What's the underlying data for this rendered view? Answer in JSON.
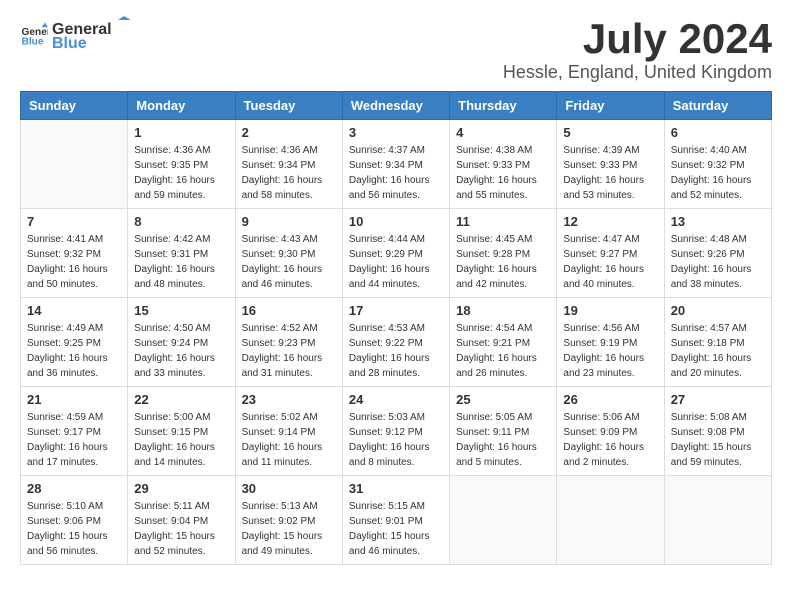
{
  "logo": {
    "general": "General",
    "blue": "Blue"
  },
  "header": {
    "title": "July 2024",
    "subtitle": "Hessle, England, United Kingdom"
  },
  "days_of_week": [
    "Sunday",
    "Monday",
    "Tuesday",
    "Wednesday",
    "Thursday",
    "Friday",
    "Saturday"
  ],
  "weeks": [
    [
      {
        "day": "",
        "info": ""
      },
      {
        "day": "1",
        "info": "Sunrise: 4:36 AM\nSunset: 9:35 PM\nDaylight: 16 hours\nand 59 minutes."
      },
      {
        "day": "2",
        "info": "Sunrise: 4:36 AM\nSunset: 9:34 PM\nDaylight: 16 hours\nand 58 minutes."
      },
      {
        "day": "3",
        "info": "Sunrise: 4:37 AM\nSunset: 9:34 PM\nDaylight: 16 hours\nand 56 minutes."
      },
      {
        "day": "4",
        "info": "Sunrise: 4:38 AM\nSunset: 9:33 PM\nDaylight: 16 hours\nand 55 minutes."
      },
      {
        "day": "5",
        "info": "Sunrise: 4:39 AM\nSunset: 9:33 PM\nDaylight: 16 hours\nand 53 minutes."
      },
      {
        "day": "6",
        "info": "Sunrise: 4:40 AM\nSunset: 9:32 PM\nDaylight: 16 hours\nand 52 minutes."
      }
    ],
    [
      {
        "day": "7",
        "info": "Sunrise: 4:41 AM\nSunset: 9:32 PM\nDaylight: 16 hours\nand 50 minutes."
      },
      {
        "day": "8",
        "info": "Sunrise: 4:42 AM\nSunset: 9:31 PM\nDaylight: 16 hours\nand 48 minutes."
      },
      {
        "day": "9",
        "info": "Sunrise: 4:43 AM\nSunset: 9:30 PM\nDaylight: 16 hours\nand 46 minutes."
      },
      {
        "day": "10",
        "info": "Sunrise: 4:44 AM\nSunset: 9:29 PM\nDaylight: 16 hours\nand 44 minutes."
      },
      {
        "day": "11",
        "info": "Sunrise: 4:45 AM\nSunset: 9:28 PM\nDaylight: 16 hours\nand 42 minutes."
      },
      {
        "day": "12",
        "info": "Sunrise: 4:47 AM\nSunset: 9:27 PM\nDaylight: 16 hours\nand 40 minutes."
      },
      {
        "day": "13",
        "info": "Sunrise: 4:48 AM\nSunset: 9:26 PM\nDaylight: 16 hours\nand 38 minutes."
      }
    ],
    [
      {
        "day": "14",
        "info": "Sunrise: 4:49 AM\nSunset: 9:25 PM\nDaylight: 16 hours\nand 36 minutes."
      },
      {
        "day": "15",
        "info": "Sunrise: 4:50 AM\nSunset: 9:24 PM\nDaylight: 16 hours\nand 33 minutes."
      },
      {
        "day": "16",
        "info": "Sunrise: 4:52 AM\nSunset: 9:23 PM\nDaylight: 16 hours\nand 31 minutes."
      },
      {
        "day": "17",
        "info": "Sunrise: 4:53 AM\nSunset: 9:22 PM\nDaylight: 16 hours\nand 28 minutes."
      },
      {
        "day": "18",
        "info": "Sunrise: 4:54 AM\nSunset: 9:21 PM\nDaylight: 16 hours\nand 26 minutes."
      },
      {
        "day": "19",
        "info": "Sunrise: 4:56 AM\nSunset: 9:19 PM\nDaylight: 16 hours\nand 23 minutes."
      },
      {
        "day": "20",
        "info": "Sunrise: 4:57 AM\nSunset: 9:18 PM\nDaylight: 16 hours\nand 20 minutes."
      }
    ],
    [
      {
        "day": "21",
        "info": "Sunrise: 4:59 AM\nSunset: 9:17 PM\nDaylight: 16 hours\nand 17 minutes."
      },
      {
        "day": "22",
        "info": "Sunrise: 5:00 AM\nSunset: 9:15 PM\nDaylight: 16 hours\nand 14 minutes."
      },
      {
        "day": "23",
        "info": "Sunrise: 5:02 AM\nSunset: 9:14 PM\nDaylight: 16 hours\nand 11 minutes."
      },
      {
        "day": "24",
        "info": "Sunrise: 5:03 AM\nSunset: 9:12 PM\nDaylight: 16 hours\nand 8 minutes."
      },
      {
        "day": "25",
        "info": "Sunrise: 5:05 AM\nSunset: 9:11 PM\nDaylight: 16 hours\nand 5 minutes."
      },
      {
        "day": "26",
        "info": "Sunrise: 5:06 AM\nSunset: 9:09 PM\nDaylight: 16 hours\nand 2 minutes."
      },
      {
        "day": "27",
        "info": "Sunrise: 5:08 AM\nSunset: 9:08 PM\nDaylight: 15 hours\nand 59 minutes."
      }
    ],
    [
      {
        "day": "28",
        "info": "Sunrise: 5:10 AM\nSunset: 9:06 PM\nDaylight: 15 hours\nand 56 minutes."
      },
      {
        "day": "29",
        "info": "Sunrise: 5:11 AM\nSunset: 9:04 PM\nDaylight: 15 hours\nand 52 minutes."
      },
      {
        "day": "30",
        "info": "Sunrise: 5:13 AM\nSunset: 9:02 PM\nDaylight: 15 hours\nand 49 minutes."
      },
      {
        "day": "31",
        "info": "Sunrise: 5:15 AM\nSunset: 9:01 PM\nDaylight: 15 hours\nand 46 minutes."
      },
      {
        "day": "",
        "info": ""
      },
      {
        "day": "",
        "info": ""
      },
      {
        "day": "",
        "info": ""
      }
    ]
  ]
}
